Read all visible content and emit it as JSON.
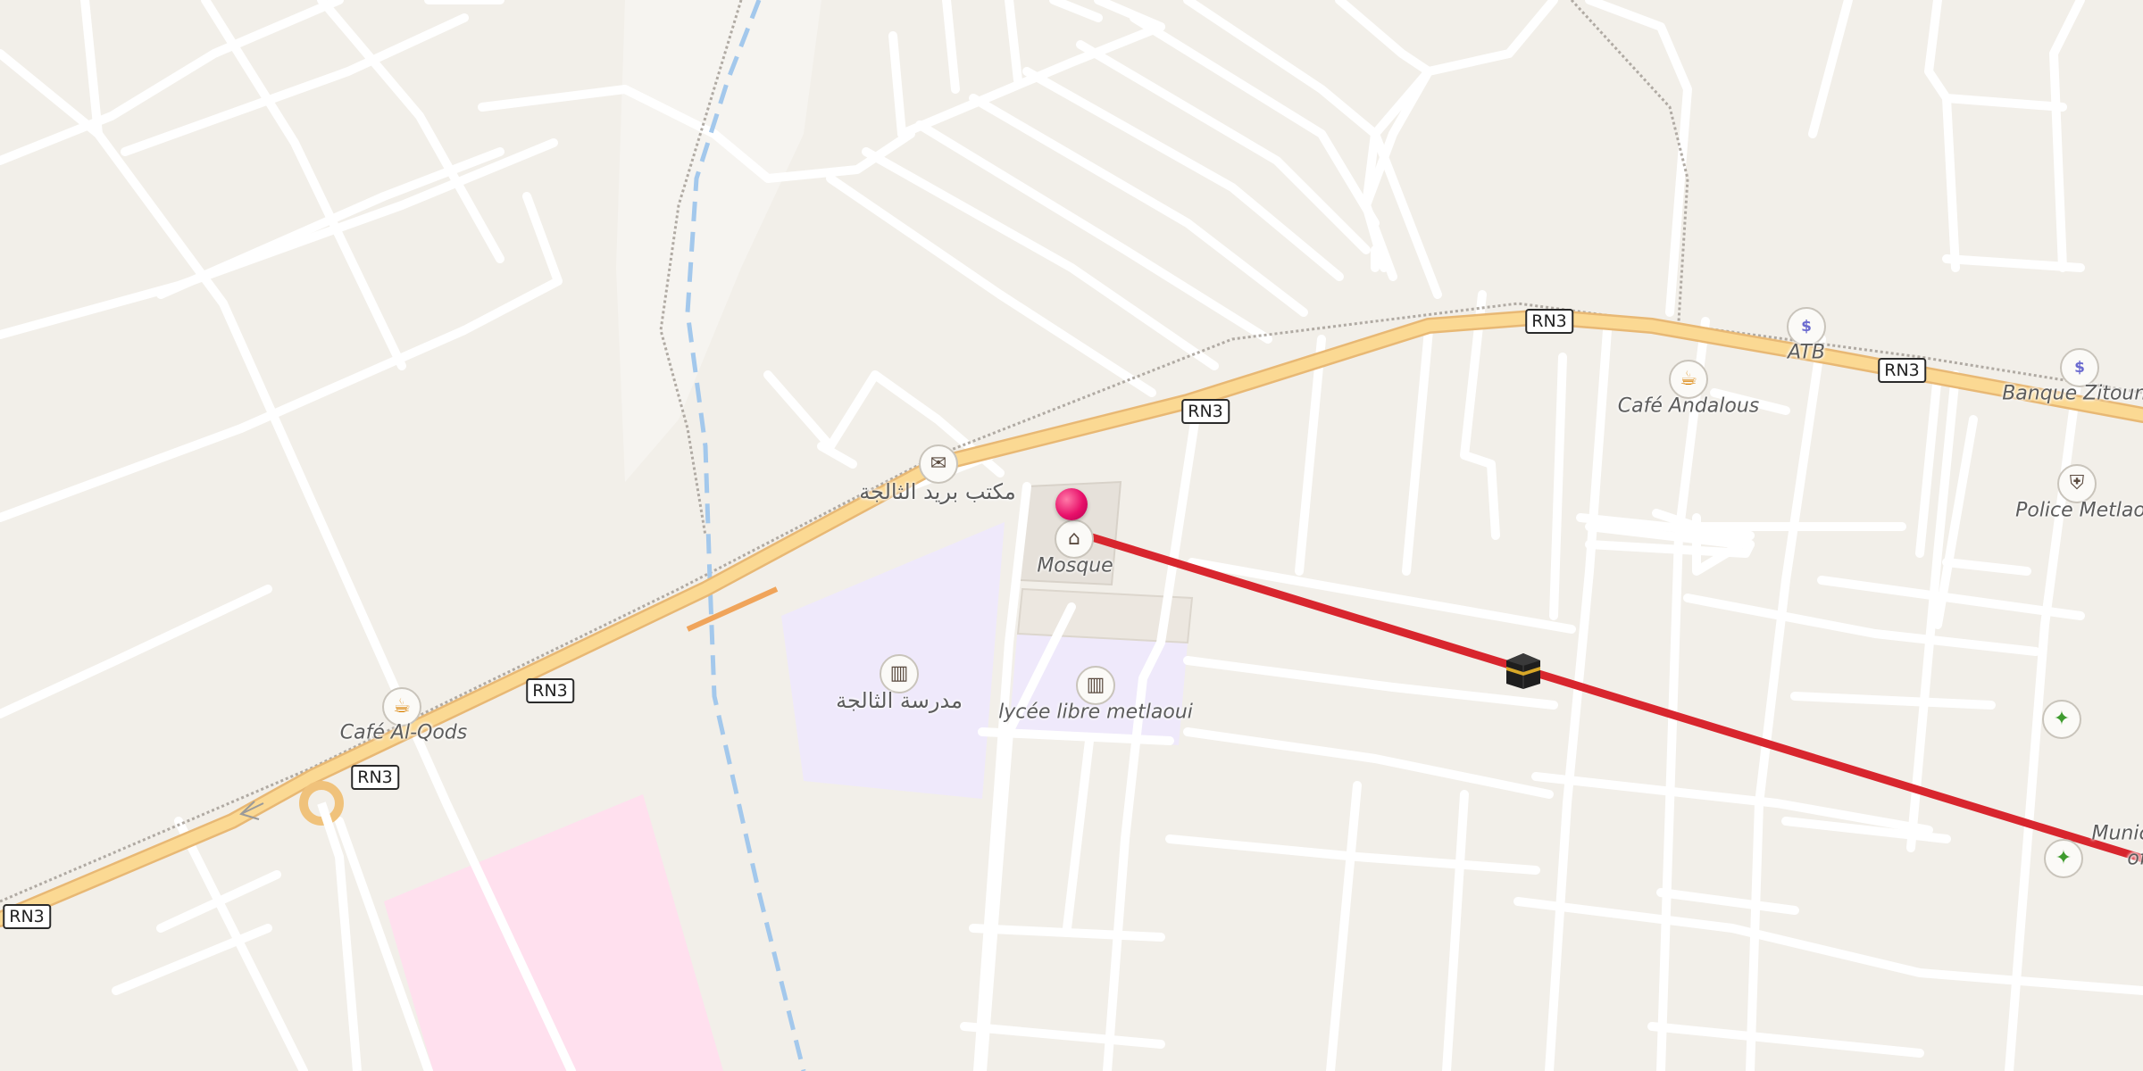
{
  "map": {
    "road_refs": [
      "RN3",
      "RN3",
      "RN3",
      "RN3",
      "RN3",
      "RN3"
    ],
    "places": {
      "post_office": "مكتب بريد الثالجة",
      "mosque": "Mosque",
      "school_ar": "مدرسة الثالجة",
      "lycee": "lycée libre metlaoui",
      "cafe_alqods": "Café Al-Qods",
      "cafe_andalous": "Café Andalous",
      "atb": "ATB",
      "banque_zitouna": "Banque Zitouna",
      "police": "Police Metlaoui",
      "municipal": "Munic",
      "municipal_line2": "of"
    },
    "icons": {
      "post": "envelope-icon",
      "mosque": "place-of-worship-icon",
      "school": "school-icon",
      "cafe": "cafe-icon",
      "bank": "bank-icon",
      "police": "police-icon",
      "sport": "sport-icon",
      "kaaba": "kaaba-qibla-icon",
      "pin": "location-pin-icon"
    },
    "colors": {
      "background": "#f2efe9",
      "road_casing": "#ffffff",
      "primary_road": "#fbd993",
      "primary_road_casing": "#e8b874",
      "railway": "#b0aaa3",
      "waterway": "#a3c8ec",
      "school_area": "#efe9fb",
      "pink_area": "#ffe0ee",
      "mosque_building": "#e5e0da",
      "qibla_line": "#d8262e",
      "pin": "#e8106a"
    }
  }
}
